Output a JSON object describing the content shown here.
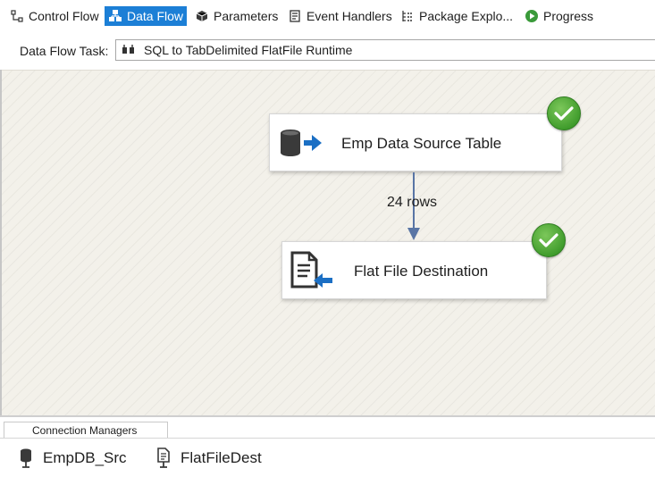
{
  "tabs": [
    {
      "label": "Control Flow",
      "icon": "control-flow-icon",
      "active": false
    },
    {
      "label": "Data Flow",
      "icon": "data-flow-icon",
      "active": true
    },
    {
      "label": "Parameters",
      "icon": "parameters-icon",
      "active": false
    },
    {
      "label": "Event Handlers",
      "icon": "event-handlers-icon",
      "active": false
    },
    {
      "label": "Package Explo...",
      "icon": "package-explorer-icon",
      "active": false
    },
    {
      "label": "Progress",
      "icon": "progress-icon",
      "active": false
    }
  ],
  "task": {
    "label": "Data Flow Task:",
    "selected": "SQL to TabDelimited FlatFile Runtime"
  },
  "components": {
    "source": {
      "label": "Emp Data Source Table",
      "status": "success"
    },
    "destination": {
      "label": "Flat File Destination",
      "status": "success"
    }
  },
  "data_path": {
    "label": "24 rows"
  },
  "connection_managers": {
    "header": "Connection Managers",
    "items": [
      {
        "label": "EmpDB_Src",
        "icon": "database-connection-icon"
      },
      {
        "label": "FlatFileDest",
        "icon": "flat-file-connection-icon"
      }
    ]
  },
  "colors": {
    "active_tab": "#1c7fd6",
    "success": "#3d9a2a",
    "path": "#5975a5",
    "surface": "#f3f1ea"
  }
}
